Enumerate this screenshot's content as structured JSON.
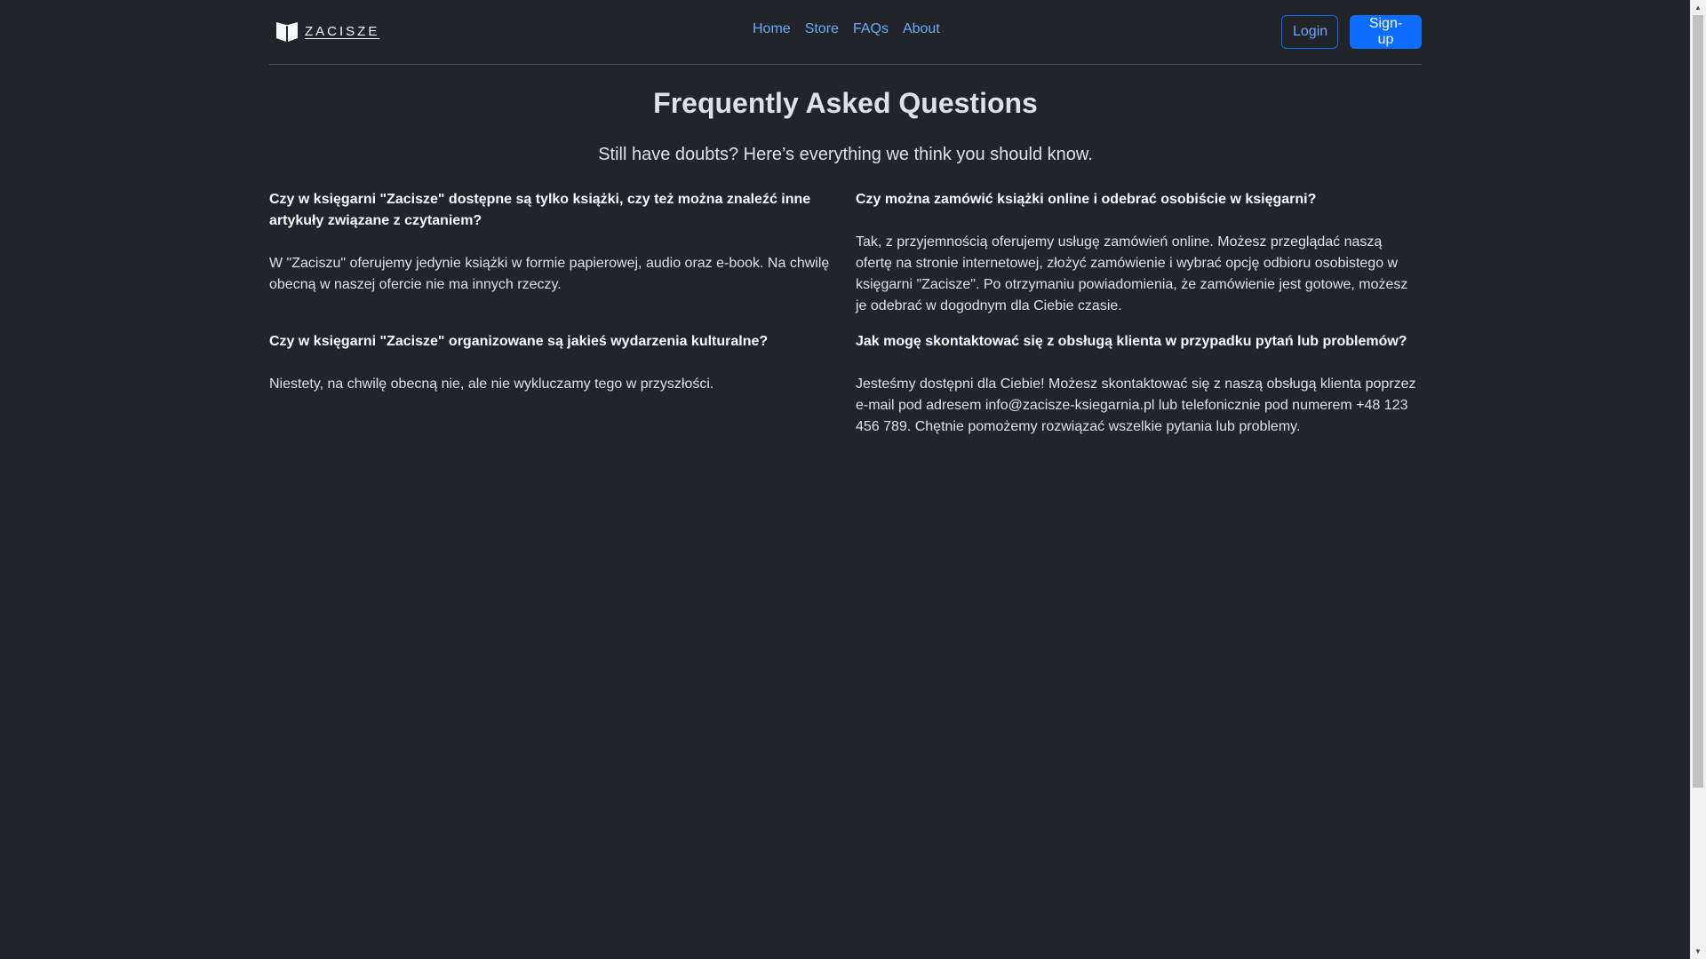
{
  "brand": {
    "name": "ZACISZE",
    "icon": "open-book-icon"
  },
  "nav": {
    "items": [
      {
        "label": "Home"
      },
      {
        "label": "Store"
      },
      {
        "label": "FAQs"
      },
      {
        "label": "About"
      }
    ]
  },
  "auth": {
    "login_label": "Login",
    "signup_label": "Sign-up"
  },
  "main": {
    "title": "Frequently Asked Questions",
    "subtitle": "Still have doubts? Here’s everything we think you should know.",
    "faqs": [
      {
        "question": "Czy w księgarni \"Zacisze\" dostępne są tylko książki, czy też można znaleźć inne artykuły związane z czytaniem?",
        "answer": "W \"Zaciszu\" oferujemy jedynie książki w formie papierowej, audio oraz e-book. Na chwilę obecną w naszej ofercie nie ma innych rzeczy."
      },
      {
        "question": "Czy można zamówić książki online i odebrać osobiście w księgarni?",
        "answer": "Tak, z przyjemnością oferujemy usługę zamówień online. Możesz przeglądać naszą ofertę na stronie internetowej, złożyć zamówienie i wybrać opcję odbioru osobistego w księgarni \"Zacisze\". Po otrzymaniu powiadomienia, że zamówienie jest gotowe, możesz je odebrać w dogodnym dla Ciebie czasie."
      },
      {
        "question": "Czy w księgarni \"Zacisze\" organizowane są jakieś wydarzenia kulturalne?",
        "answer": "Niestety, na chwilę obecną nie, ale nie wykluczamy tego w przyszłości."
      },
      {
        "question": "Jak mogę skontaktować się z obsługą klienta w przypadku pytań lub problemów?",
        "answer": "Jesteśmy dostępni dla Ciebie! Możesz skontaktować się z naszą obsługą klienta poprzez e-mail pod adresem info@zacisze-ksiegarnia.pl lub telefonicznie pod numerem +48 123 456 789. Chętnie pomożemy rozwiązać wszelkie pytania lub problemy."
      }
    ]
  },
  "colors": {
    "background": "#212529",
    "text": "#dee2e6",
    "link": "#6ea8fe",
    "primary": "#0d6efd"
  }
}
